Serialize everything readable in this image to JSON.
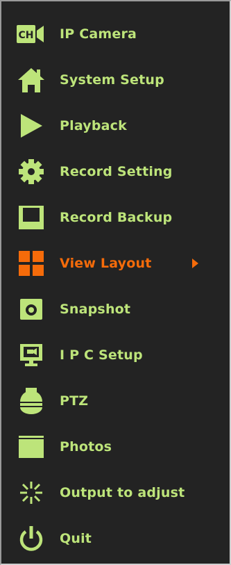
{
  "colors": {
    "accent": "#bde47a",
    "active": "#f56b0a",
    "background": "#232323"
  },
  "menu": {
    "items": [
      {
        "label": "IP Camera",
        "icon": "ip-camera-icon",
        "badge": "CH"
      },
      {
        "label": "System Setup",
        "icon": "home-icon"
      },
      {
        "label": "Playback",
        "icon": "play-icon"
      },
      {
        "label": "Record Setting",
        "icon": "gear-icon"
      },
      {
        "label": "Record Backup",
        "icon": "floppy-disk-icon"
      },
      {
        "label": "View Layout",
        "icon": "grid-layout-icon",
        "active": true,
        "has_submenu": true
      },
      {
        "label": "Snapshot",
        "icon": "camera-icon"
      },
      {
        "label": "I P C  Setup",
        "icon": "monitor-icon"
      },
      {
        "label": "PTZ",
        "icon": "ptz-dome-icon"
      },
      {
        "label": "Photos",
        "icon": "folder-icon"
      },
      {
        "label": "Output to adjust",
        "icon": "brightness-icon"
      },
      {
        "label": "Quit",
        "icon": "power-icon"
      }
    ]
  }
}
